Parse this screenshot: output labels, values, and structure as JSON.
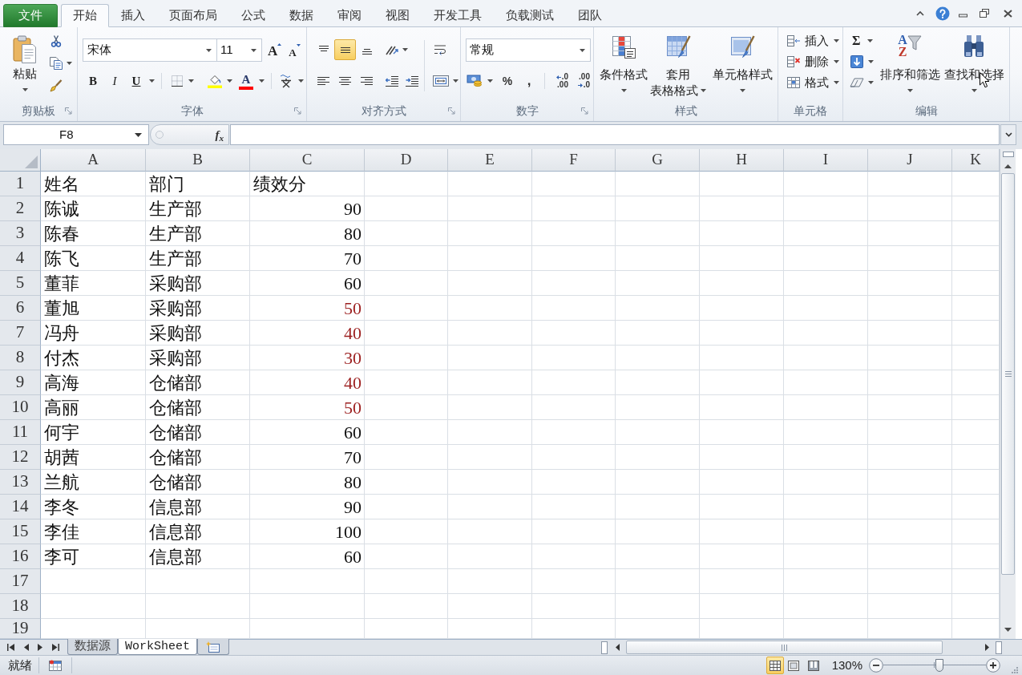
{
  "ribbon_tabs": [
    {
      "label": "文件",
      "kind": "file",
      "selected": false
    },
    {
      "label": "开始",
      "kind": "tab",
      "selected": true
    },
    {
      "label": "插入",
      "kind": "tab",
      "selected": false
    },
    {
      "label": "页面布局",
      "kind": "tab",
      "selected": false
    },
    {
      "label": "公式",
      "kind": "tab",
      "selected": false
    },
    {
      "label": "数据",
      "kind": "tab",
      "selected": false
    },
    {
      "label": "审阅",
      "kind": "tab",
      "selected": false
    },
    {
      "label": "视图",
      "kind": "tab",
      "selected": false
    },
    {
      "label": "开发工具",
      "kind": "tab",
      "selected": false
    },
    {
      "label": "负载测试",
      "kind": "tab",
      "selected": false
    },
    {
      "label": "团队",
      "kind": "tab",
      "selected": false
    }
  ],
  "ribbon": {
    "clipboard": {
      "label": "剪贴板",
      "paste": "粘贴"
    },
    "font": {
      "label": "字体",
      "font_name": "宋体",
      "font_size": "11",
      "grow_font": "A",
      "shrink_font": "A",
      "bold": "B",
      "italic": "I",
      "underline": "U",
      "font_color": "A"
    },
    "alignment": {
      "label": "对齐方式",
      "vertical_align": [
        {
          "selected": false
        },
        {
          "selected": true
        },
        {
          "selected": false
        }
      ]
    },
    "number": {
      "label": "数字",
      "format": "常规",
      "percent": "%",
      "comma": ",",
      "increase_decimal": [
        ".0",
        ".00"
      ],
      "decrease_decimal": [
        ".00",
        ".0"
      ]
    },
    "styles": {
      "label": "样式",
      "buttons": [
        {
          "lines": [
            "条件格式"
          ]
        },
        {
          "lines": [
            "套用",
            "表格格式"
          ]
        },
        {
          "lines": [
            "单元格样式"
          ]
        }
      ]
    },
    "cells": {
      "label": "单元格",
      "buttons": [
        "插入",
        "删除",
        "格式"
      ]
    },
    "editing": {
      "label": "编辑",
      "autosum": "Σ",
      "sort_icon": [
        "A",
        "Z"
      ],
      "buttons": [
        "排序和筛选",
        "查找和选择"
      ]
    }
  },
  "formula_bar": {
    "name_box": "F8",
    "function_button": "f$_{x}$"
  },
  "sheet": {
    "columns": [
      "A",
      "B",
      "C",
      "D",
      "E",
      "F",
      "G",
      "H",
      "I",
      "J",
      "K"
    ],
    "rows": [
      {
        "number": "1",
        "kind": "header",
        "cells": [
          "姓名",
          "部门",
          "绩效分"
        ],
        "highlighted": false
      },
      {
        "number": "2",
        "kind": "data",
        "cells": [
          "陈诚",
          "生产部",
          "90"
        ],
        "highlighted": false
      },
      {
        "number": "3",
        "kind": "data",
        "cells": [
          "陈春",
          "生产部",
          "80"
        ],
        "highlighted": false
      },
      {
        "number": "4",
        "kind": "data",
        "cells": [
          "陈飞",
          "生产部",
          "70"
        ],
        "highlighted": false
      },
      {
        "number": "5",
        "kind": "data",
        "cells": [
          "董菲",
          "采购部",
          "60"
        ],
        "highlighted": false
      },
      {
        "number": "6",
        "kind": "data",
        "cells": [
          "董旭",
          "采购部",
          "50"
        ],
        "highlighted": true
      },
      {
        "number": "7",
        "kind": "data",
        "cells": [
          "冯舟",
          "采购部",
          "40"
        ],
        "highlighted": true
      },
      {
        "number": "8",
        "kind": "data",
        "cells": [
          "付杰",
          "采购部",
          "30"
        ],
        "highlighted": true
      },
      {
        "number": "9",
        "kind": "data",
        "cells": [
          "高海",
          "仓储部",
          "40"
        ],
        "highlighted": true
      },
      {
        "number": "10",
        "kind": "data",
        "cells": [
          "高丽",
          "仓储部",
          "50"
        ],
        "highlighted": true
      },
      {
        "number": "11",
        "kind": "data",
        "cells": [
          "何宇",
          "仓储部",
          "60"
        ],
        "highlighted": false
      },
      {
        "number": "12",
        "kind": "data",
        "cells": [
          "胡茜",
          "仓储部",
          "70"
        ],
        "highlighted": false
      },
      {
        "number": "13",
        "kind": "data",
        "cells": [
          "兰航",
          "仓储部",
          "80"
        ],
        "highlighted": false
      },
      {
        "number": "14",
        "kind": "data",
        "cells": [
          "李冬",
          "信息部",
          "90"
        ],
        "highlighted": false
      },
      {
        "number": "15",
        "kind": "data",
        "cells": [
          "李佳",
          "信息部",
          "100"
        ],
        "highlighted": false
      },
      {
        "number": "16",
        "kind": "data",
        "cells": [
          "李可",
          "信息部",
          "60"
        ],
        "highlighted": false
      },
      {
        "number": "17"
      },
      {
        "number": "18"
      },
      {
        "number": "19"
      }
    ]
  },
  "sheet_tabs": [
    {
      "label": "数据源",
      "selected": false
    },
    {
      "label": "WorkSheet",
      "selected": true
    }
  ],
  "status_bar": {
    "status": "就绪",
    "view_buttons": [
      {
        "selected": true
      },
      {
        "selected": false
      },
      {
        "selected": false
      }
    ],
    "zoom": {
      "label": "130%",
      "level": 0.55
    }
  }
}
